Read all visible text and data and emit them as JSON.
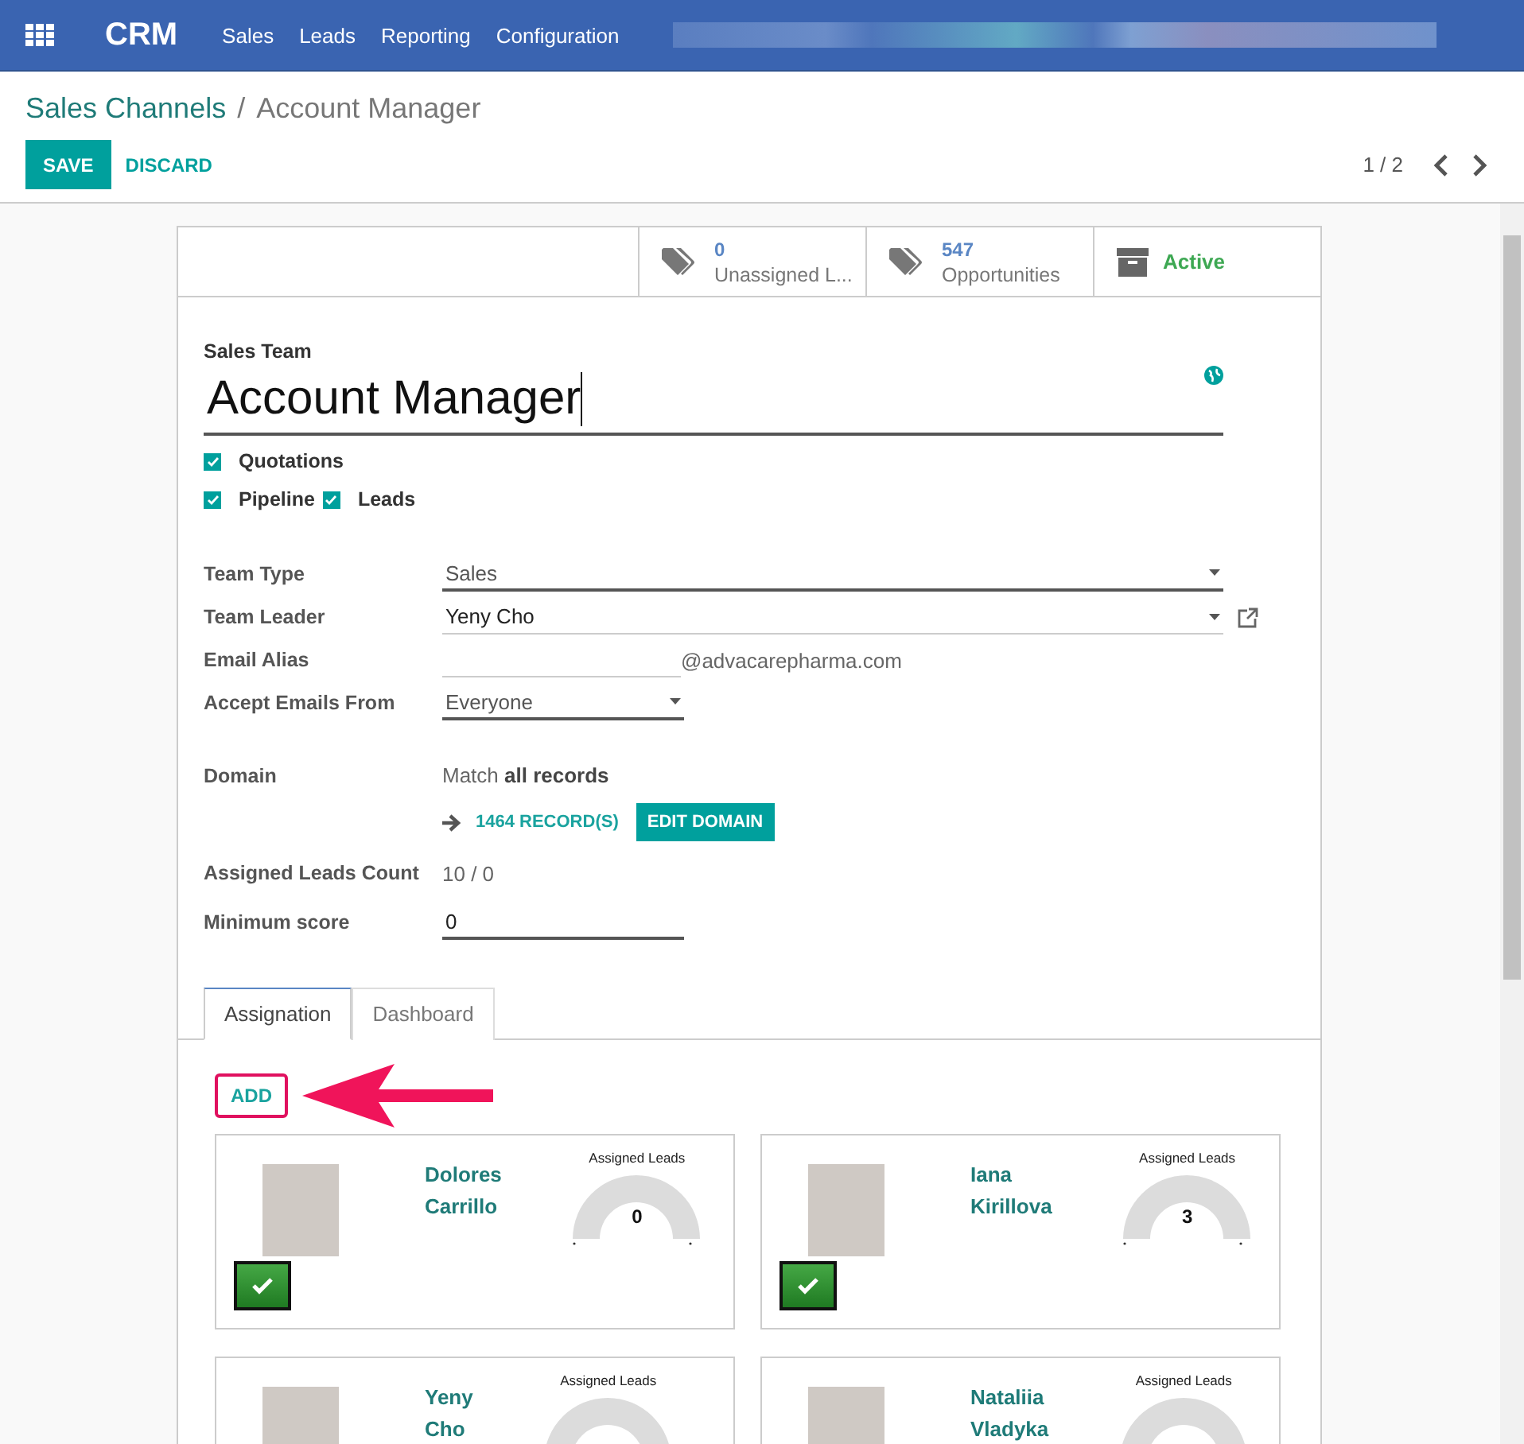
{
  "navbar": {
    "app_name": "CRM",
    "menu": [
      "Sales",
      "Leads",
      "Reporting",
      "Configuration"
    ]
  },
  "breadcrumb": {
    "parent": "Sales Channels",
    "separator": "/",
    "current": "Account Manager"
  },
  "actions": {
    "save": "SAVE",
    "discard": "DISCARD"
  },
  "pager": {
    "text": "1 / 2"
  },
  "smart_buttons": [
    {
      "kind": "stat",
      "value": "0",
      "label": "Unassigned L..."
    },
    {
      "kind": "stat",
      "value": "547",
      "label": "Opportunities"
    },
    {
      "kind": "archive",
      "label": "Active"
    }
  ],
  "form": {
    "title_label": "Sales Team",
    "title": "Account Manager",
    "option_lines": [
      [
        {
          "label": "Quotations",
          "checked": true
        }
      ],
      [
        {
          "label": "Pipeline",
          "checked": true
        },
        {
          "label": "Leads",
          "checked": true
        }
      ]
    ],
    "fields": [
      {
        "kind": "select",
        "label": "Team Type",
        "value": "Sales"
      },
      {
        "kind": "many2one",
        "label": "Team Leader",
        "value": "Yeny Cho"
      },
      {
        "kind": "alias",
        "label": "Email Alias",
        "suffix": "@advacarepharma.com"
      },
      {
        "kind": "short_select",
        "label": "Accept Emails From",
        "value": "Everyone"
      }
    ],
    "domain": {
      "label": "Domain",
      "prefix": "Match",
      "bold": "all records",
      "records": "1464 RECORD(S)",
      "edit": "EDIT DOMAIN"
    },
    "fields2": [
      {
        "kind": "text",
        "label": "Assigned Leads Count",
        "value": "10 / 0"
      },
      {
        "kind": "input",
        "label": "Minimum score",
        "value": "0"
      }
    ]
  },
  "tabs": [
    {
      "label": "Assignation",
      "selected": true
    },
    {
      "label": "Dashboard",
      "selected": false
    }
  ],
  "add_button": "ADD",
  "members": [
    {
      "name": "Dolores Carrillo",
      "gauge_title": "Assigned Leads",
      "gauge_value": "0",
      "checked": true
    },
    {
      "name": "Iana Kirillova",
      "gauge_title": "Assigned Leads",
      "gauge_value": "3",
      "checked": true
    },
    {
      "name": "Yeny Cho",
      "gauge_title": "Assigned Leads"
    },
    {
      "name": "Nataliia Vladyka",
      "gauge_title": "Assigned Leads"
    }
  ]
}
